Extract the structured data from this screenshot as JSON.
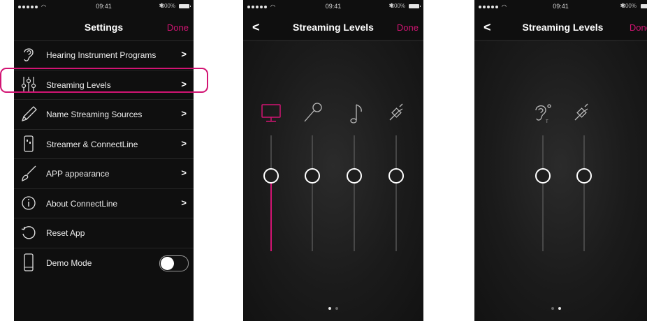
{
  "status": {
    "time": "09:41",
    "battery": "100%"
  },
  "settings": {
    "title": "Settings",
    "done": "Done",
    "items": [
      {
        "label": "Hearing Instrument Programs",
        "icon": "ear-icon",
        "chevron": ">"
      },
      {
        "label": "Streaming Levels",
        "icon": "sliders-icon",
        "chevron": ">"
      },
      {
        "label": "Name Streaming Sources",
        "icon": "pencil-icon",
        "chevron": ">"
      },
      {
        "label": "Streamer & ConnectLine",
        "icon": "streamer-device-icon",
        "chevron": ">"
      },
      {
        "label": "APP appearance",
        "icon": "brush-icon",
        "chevron": ">"
      },
      {
        "label": "About ConnectLine",
        "icon": "info-icon",
        "chevron": ">"
      },
      {
        "label": "Reset App",
        "icon": "reset-icon"
      },
      {
        "label": "Demo Mode",
        "icon": "phone-icon",
        "toggle": false
      }
    ]
  },
  "streaming1": {
    "title": "Streaming Levels",
    "done": "Done",
    "back": "<",
    "sliders": [
      {
        "icon": "tv-icon",
        "level": 0.0,
        "active": true
      },
      {
        "icon": "microphone-icon",
        "level": 0.0
      },
      {
        "icon": "music-note-icon",
        "level": 0.0
      },
      {
        "icon": "cable-plug-icon",
        "level": 0.0
      }
    ],
    "page": 1
  },
  "streaming2": {
    "title": "Streaming Levels",
    "done": "Done",
    "back": "<",
    "sliders": [
      {
        "icon": "telecoil-ear-icon",
        "level": 0.0
      },
      {
        "icon": "cable-plug-icon",
        "level": 0.0
      }
    ],
    "page": 2
  },
  "colors": {
    "accent": "#d21473",
    "background": "#1b1b1b"
  }
}
